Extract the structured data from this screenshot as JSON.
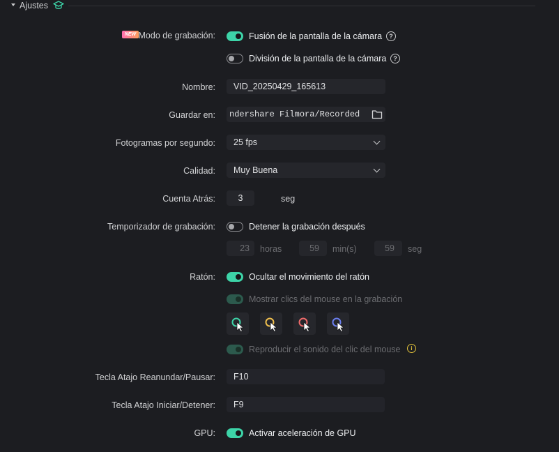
{
  "section": {
    "title": "Ajustes"
  },
  "recording_mode": {
    "badge": "NEW",
    "label": "Modo de grabación:",
    "option1": "Fusión de la pantalla de la cámara",
    "option2": "División de la pantalla de la cámara",
    "option1_on": true,
    "option2_on": false
  },
  "name": {
    "label": "Nombre:",
    "value": "VID_20250429_165613"
  },
  "save_to": {
    "label": "Guardar en:",
    "value": "ndershare Filmora/Recorded"
  },
  "fps": {
    "label": "Fotogramas por segundo:",
    "value": "25 fps"
  },
  "quality": {
    "label": "Calidad:",
    "value": "Muy Buena"
  },
  "countdown": {
    "label": "Cuenta Atrás:",
    "value": "3",
    "unit": "seg"
  },
  "timer": {
    "label": "Temporizador de grabación:",
    "toggle_label": "Detener la grabación después",
    "on": false,
    "hours": "23",
    "hours_unit": "horas",
    "minutes": "59",
    "minutes_unit": "min(s)",
    "seconds": "59",
    "seconds_unit": "seg"
  },
  "mouse": {
    "label": "Ratón:",
    "hide_movement": "Ocultar el movimiento del ratón",
    "show_clicks": "Mostrar clics del mouse en la grabación",
    "play_click_sound": "Reproducir el sonido del clic del mouse",
    "cursor_colors": [
      "#3dd4a8",
      "#f2c14e",
      "#f06b6b",
      "#6b7ff0"
    ],
    "warn_color": "#e3c33a"
  },
  "hotkey_pause": {
    "label": "Tecla Atajo Reanundar/Pausar:",
    "value": "F10"
  },
  "hotkey_start": {
    "label": "Tecla Atajo Iniciar/Detener:",
    "value": "F9"
  },
  "gpu": {
    "label": "GPU:",
    "option": "Activar aceleración de GPU",
    "on": true
  },
  "colors": {
    "accent": "#3dd4a8",
    "background": "#1c1d21",
    "field": "#25262b"
  }
}
